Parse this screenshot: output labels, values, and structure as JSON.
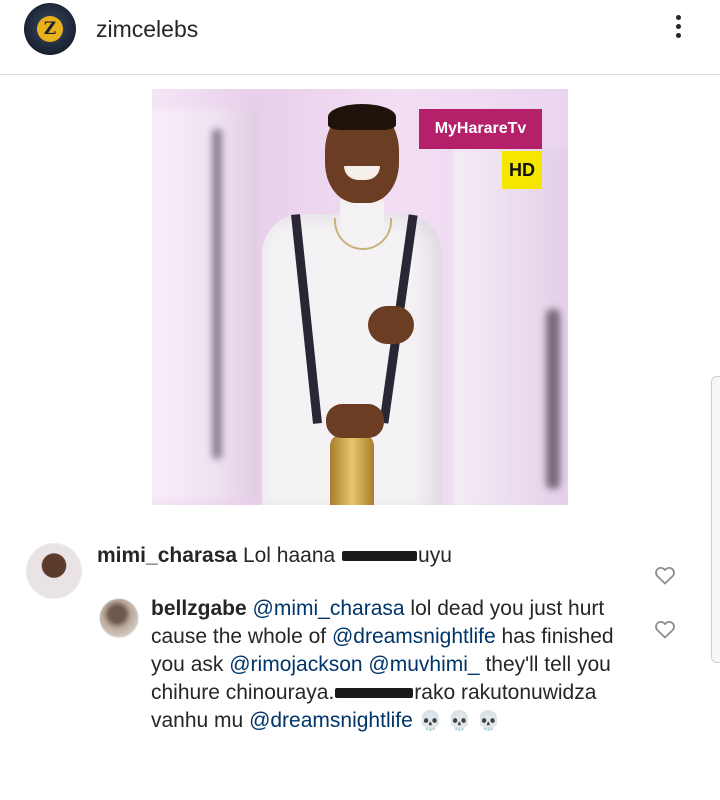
{
  "header": {
    "username": "zimcelebs",
    "avatar_icon": "zimcelebs-logo-icon",
    "more_icon": "more-vertical-icon"
  },
  "post": {
    "overlay_badge": "MyHarareTv",
    "hd_badge": "HD",
    "colors": {
      "badge_tv": "#b5206b",
      "badge_hd": "#f5e600"
    }
  },
  "comments": [
    {
      "username": "mimi_charasa",
      "text_before": "Lol haana ",
      "text_after": "uyu",
      "redacted": true
    },
    {
      "username": "bellzgabe",
      "parts": {
        "m1": "@mimi_charasa",
        "t1": " lol dead you just hurt cause the whole of ",
        "m2": "@dreamsnightlife",
        "t2": " has finished you ask ",
        "m3": "@rimojackson",
        "t3": " ",
        "m4": "@muvhimi_",
        "t4": " they'll tell you chihure chinouraya.",
        "t5": "rako rakutonuwidza vanhu mu ",
        "m5": "@dreamsnightlife",
        "emoji": "💀 💀 💀"
      }
    }
  ],
  "icons": {
    "like": "heart-outline-icon"
  }
}
